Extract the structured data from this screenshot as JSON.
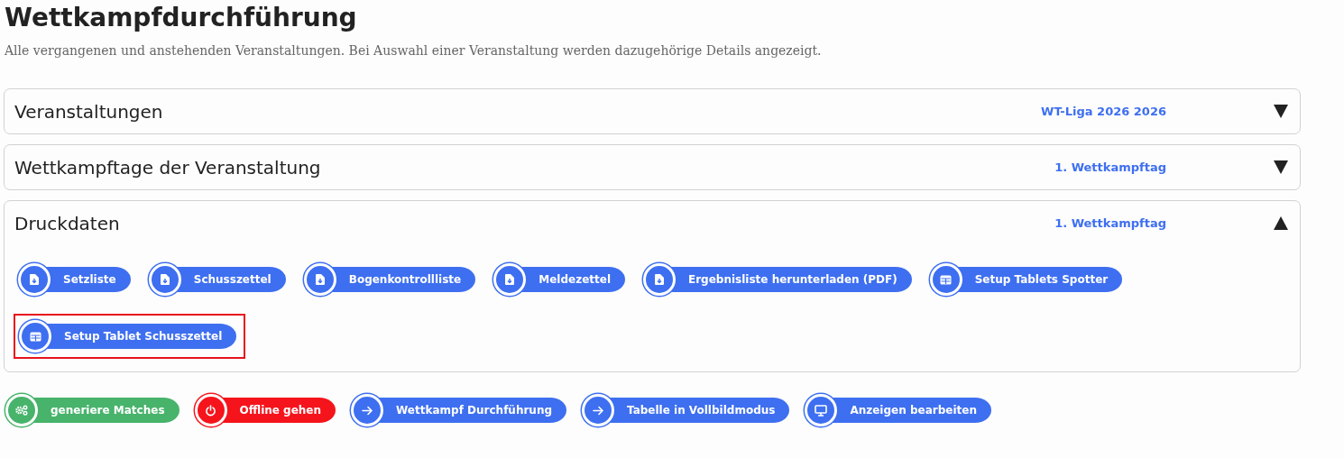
{
  "page": {
    "title": "Wettkampfdurchführung",
    "subtitle": "Alle vergangenen und anstehenden Veranstaltungen. Bei Auswahl einer Veranstaltung werden dazugehörige Details angezeigt."
  },
  "panels": [
    {
      "title": "Veranstaltungen",
      "value": "WT-Liga 2026 2026",
      "expanded": false
    },
    {
      "title": "Wettkampftage der Veranstaltung",
      "value": "1. Wettkampftag",
      "expanded": false
    },
    {
      "title": "Druckdaten",
      "value": "1. Wettkampftag",
      "expanded": true,
      "buttons": [
        {
          "label": "Setzliste",
          "kind": "file",
          "color": "#3e6ff0",
          "highlighted": false
        },
        {
          "label": "Schusszettel",
          "kind": "file",
          "color": "#3e6ff0",
          "highlighted": false
        },
        {
          "label": "Bogenkontrollliste",
          "kind": "file",
          "color": "#3e6ff0",
          "highlighted": false
        },
        {
          "label": "Meldezettel",
          "kind": "file",
          "color": "#3e6ff0",
          "highlighted": false
        },
        {
          "label": "Ergebnisliste herunterladen (PDF)",
          "kind": "file",
          "color": "#3e6ff0",
          "highlighted": false
        },
        {
          "label": "Setup Tablets Spotter",
          "kind": "table",
          "color": "#3e6ff0",
          "highlighted": false
        },
        {
          "label": "Setup Tablet Schusszettel",
          "kind": "table",
          "color": "#3e6ff0",
          "highlighted": true
        }
      ]
    }
  ],
  "actions": [
    {
      "label": "generiere Matches",
      "kind": "gears",
      "color": "#47b36b"
    },
    {
      "label": "Offline gehen",
      "kind": "power",
      "color": "#f5141c"
    },
    {
      "label": "Wettkampf Durchführung",
      "kind": "arrow",
      "color": "#3e6ff0"
    },
    {
      "label": "Tabelle in Vollbildmodus",
      "kind": "arrow",
      "color": "#3e6ff0"
    },
    {
      "label": "Anzeigen bearbeiten",
      "kind": "monitor",
      "color": "#3e6ff0"
    }
  ]
}
